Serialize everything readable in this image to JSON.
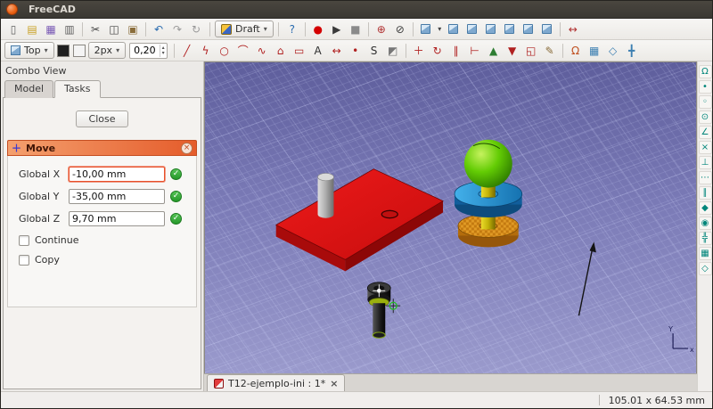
{
  "titlebar": {
    "title": "FreeCAD"
  },
  "toolbar_main": {
    "workbench": {
      "label": "Draft",
      "arrow": "▾"
    },
    "icons": [
      {
        "name": "new-document-button",
        "glyph": "▯",
        "color": "#5f5f5f"
      },
      {
        "name": "open-document-button",
        "glyph": "▤",
        "color": "#c9a227"
      },
      {
        "name": "save-document-button",
        "glyph": "▦",
        "color": "#7a5ab5"
      },
      {
        "name": "print-button",
        "glyph": "▥",
        "color": "#5f5f5f"
      },
      {
        "type": "sep"
      },
      {
        "name": "cut-button",
        "glyph": "✂",
        "color": "#444444"
      },
      {
        "name": "copy-button",
        "glyph": "◫",
        "color": "#444444"
      },
      {
        "name": "paste-button",
        "glyph": "▣",
        "color": "#8a6d3b"
      },
      {
        "type": "sep"
      },
      {
        "name": "undo-button",
        "glyph": "↶",
        "color": "#2a6cb0"
      },
      {
        "name": "redo-button",
        "glyph": "↷",
        "color": "#9a9a9a"
      },
      {
        "name": "refresh-button",
        "glyph": "↻",
        "color": "#9a9a9a"
      }
    ],
    "icons_right": [
      {
        "name": "whatsthis-button",
        "glyph": "?",
        "color": "#2a6cb0"
      },
      {
        "type": "sep"
      },
      {
        "name": "macro-record-button",
        "glyph": "●",
        "color": "#d40000"
      },
      {
        "name": "macro-execute-button",
        "glyph": "▶",
        "color": "#3a3a3a"
      },
      {
        "name": "macro-stop-button",
        "glyph": "■",
        "color": "#8a8a8a"
      },
      {
        "type": "sep"
      },
      {
        "name": "view-fit-all-button",
        "glyph": "⊕",
        "color": "#b03030"
      },
      {
        "name": "view-draw-style-button",
        "glyph": "⊘",
        "color": "#3a3a3a"
      },
      {
        "type": "sep"
      },
      {
        "name": "view-isometric-button",
        "type": "cube"
      },
      {
        "name": "view-menu-arrow",
        "glyph": "▾",
        "type": "narrow",
        "color": "#444444"
      },
      {
        "name": "view-front-button",
        "type": "cube"
      },
      {
        "name": "view-top-button",
        "type": "cube"
      },
      {
        "name": "view-right-button",
        "type": "cube"
      },
      {
        "name": "view-rear-button",
        "type": "cube"
      },
      {
        "name": "view-bottom-button",
        "type": "cube"
      },
      {
        "name": "view-left-button",
        "type": "cube"
      },
      {
        "type": "sep"
      },
      {
        "name": "measure-distance-button",
        "glyph": "↔",
        "color": "#b03030"
      }
    ]
  },
  "toolbar_draft": {
    "working_plane": {
      "label": "Top",
      "arrow": "▾"
    },
    "line_width": {
      "label": "2px",
      "arrow": "▾"
    },
    "snap_spinner": {
      "value": "0,20",
      "up": "▴",
      "down": "▾"
    },
    "icons": [
      {
        "type": "sep"
      },
      {
        "name": "draft-line-button",
        "glyph": "╱",
        "color": "#b02020"
      },
      {
        "name": "draft-polyline-button",
        "glyph": "ϟ",
        "color": "#b02020"
      },
      {
        "name": "draft-circle-button",
        "glyph": "○",
        "color": "#b02020"
      },
      {
        "name": "draft-arc-button",
        "glyph": "⌒",
        "color": "#b02020"
      },
      {
        "name": "draft-bspline-button",
        "glyph": "∿",
        "color": "#b02020"
      },
      {
        "name": "draft-polygon-button",
        "glyph": "⌂",
        "color": "#b02020"
      },
      {
        "name": "draft-rectangle-button",
        "glyph": "▭",
        "color": "#b02020"
      },
      {
        "name": "draft-text-button",
        "glyph": "A",
        "color": "#303030"
      },
      {
        "name": "draft-dimension-button",
        "glyph": "↔",
        "color": "#b02020"
      },
      {
        "name": "draft-point-button",
        "glyph": "•",
        "color": "#b02020"
      },
      {
        "name": "draft-shapestring-button",
        "glyph": "S",
        "color": "#303030"
      },
      {
        "name": "draft-facebinder-button",
        "glyph": "◩",
        "color": "#777777"
      },
      {
        "type": "sep"
      },
      {
        "name": "draft-move-button",
        "glyph": "＋",
        "color": "#b02020"
      },
      {
        "name": "draft-rotate-button",
        "glyph": "↻",
        "color": "#b02020"
      },
      {
        "name": "draft-offset-button",
        "glyph": "∥",
        "color": "#b02020"
      },
      {
        "name": "draft-trimex-button",
        "glyph": "⊢",
        "color": "#b02020"
      },
      {
        "name": "draft-upgrade-button",
        "glyph": "▲",
        "color": "#2e7d32"
      },
      {
        "name": "draft-downgrade-button",
        "glyph": "▼",
        "color": "#b02020"
      },
      {
        "name": "draft-scale-button",
        "glyph": "◱",
        "color": "#b02020"
      },
      {
        "name": "draft-edit-button",
        "glyph": "✎",
        "color": "#8a6d3b"
      },
      {
        "type": "sep"
      },
      {
        "name": "snap-lock-button",
        "glyph": "Ω",
        "color": "#c05020"
      },
      {
        "name": "toggle-grid-button",
        "glyph": "▦",
        "color": "#3c7fb1"
      },
      {
        "name": "working-plane-button",
        "glyph": "◇",
        "color": "#3c7fb1"
      },
      {
        "name": "toggle-ortho-button",
        "glyph": "╋",
        "color": "#3c7fb1"
      }
    ]
  },
  "combo_view": {
    "dock_title": "Combo View",
    "tabs": [
      {
        "name": "tab-model",
        "label": "Model"
      },
      {
        "name": "tab-tasks",
        "label": "Tasks",
        "type": "active"
      }
    ],
    "close_button_label": "Close",
    "task": {
      "title": "Move",
      "icon_glyph": "＋",
      "close_glyph": "×",
      "check_glyph": "✓",
      "fields": [
        {
          "name": "global-x-field",
          "label": "Global X",
          "value": "-10,00 mm",
          "type": "focused"
        },
        {
          "name": "global-y-field",
          "label": "Global Y",
          "value": "-35,00 mm"
        },
        {
          "name": "global-z-field",
          "label": "Global Z",
          "value": "9,70 mm"
        }
      ],
      "checkboxes": [
        {
          "name": "continue-checkbox",
          "label": "Continue",
          "checked": false
        },
        {
          "name": "copy-checkbox",
          "label": "Copy",
          "checked": false
        }
      ]
    }
  },
  "right_toolbar": {
    "icons": [
      {
        "name": "snap-lock-toggle",
        "glyph": "Ω"
      },
      {
        "name": "snap-endpoint-toggle",
        "glyph": "•"
      },
      {
        "name": "snap-midpoint-toggle",
        "glyph": "◦"
      },
      {
        "name": "snap-center-toggle",
        "glyph": "⊙"
      },
      {
        "name": "snap-angle-toggle",
        "glyph": "∠"
      },
      {
        "name": "snap-intersection-toggle",
        "glyph": "×"
      },
      {
        "name": "snap-perpendicular-toggle",
        "glyph": "⊥"
      },
      {
        "name": "snap-extension-toggle",
        "glyph": "⋯"
      },
      {
        "name": "snap-parallel-toggle",
        "glyph": "∥"
      },
      {
        "name": "snap-special-toggle",
        "glyph": "◆"
      },
      {
        "name": "snap-near-toggle",
        "glyph": "◉"
      },
      {
        "name": "snap-ortho-toggle",
        "glyph": "╬"
      },
      {
        "name": "snap-grid-toggle",
        "glyph": "▦"
      },
      {
        "name": "snap-working-plane-toggle",
        "glyph": "◇"
      }
    ]
  },
  "viewport": {
    "doc_tab": {
      "label": "T12-ejemplo-ini : 1*",
      "close_glyph": "×"
    },
    "axis": {
      "x_label": "x",
      "y_label": "Y"
    }
  },
  "statusbar": {
    "measurement": "105.01 x 64.53 mm"
  },
  "colors": {
    "accent_orange": "#e8502a",
    "task_header": "#e96434",
    "valid_green": "#2fa832",
    "viewport_top": "#5e5e9c",
    "viewport_bottom": "#9a9acc",
    "object_red": "#d81414",
    "object_blue": "#2b9ad8",
    "object_green": "#5ec802",
    "object_yellow": "#d8c410",
    "object_orange": "#d88d1d"
  }
}
